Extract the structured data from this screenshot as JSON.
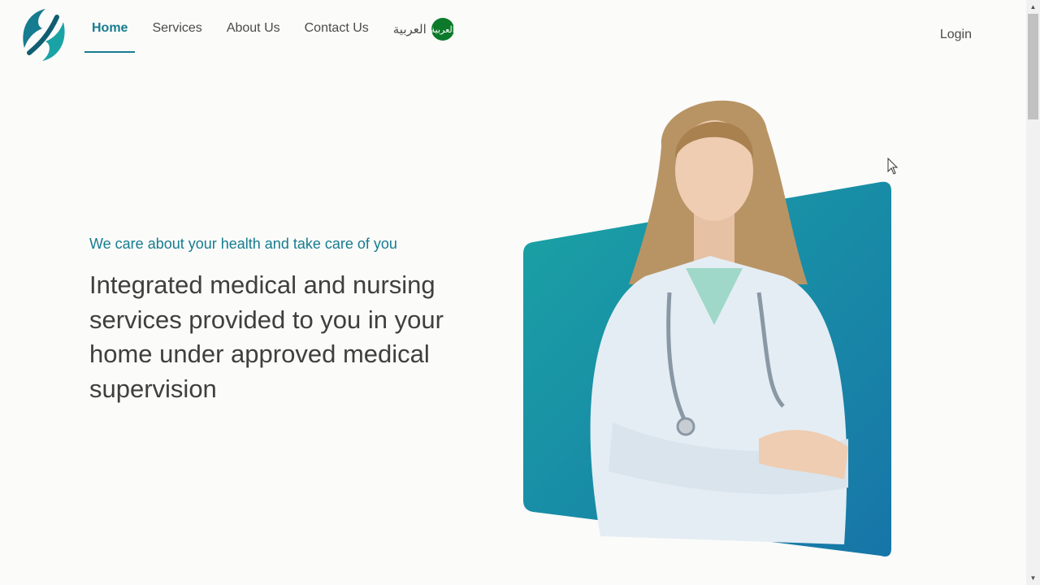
{
  "nav": {
    "items": [
      {
        "label": "Home",
        "active": true
      },
      {
        "label": "Services"
      },
      {
        "label": "About Us"
      },
      {
        "label": "Contact Us"
      }
    ],
    "language_label": "العربية",
    "language_badge": "العربية",
    "login_label": "Login"
  },
  "hero": {
    "tagline": "We care about your health and take care of you",
    "headline": "Integrated medical and nursing services provided to you in your home under approved medical supervision"
  },
  "colors": {
    "brand_teal": "#167c90",
    "panel_gradient_start": "#1aa3a4",
    "panel_gradient_end": "#1775a8",
    "language_badge": "#0c7a2a"
  },
  "icons": {
    "logo": "brand-leaf-logo",
    "language": "language-badge-icon"
  }
}
